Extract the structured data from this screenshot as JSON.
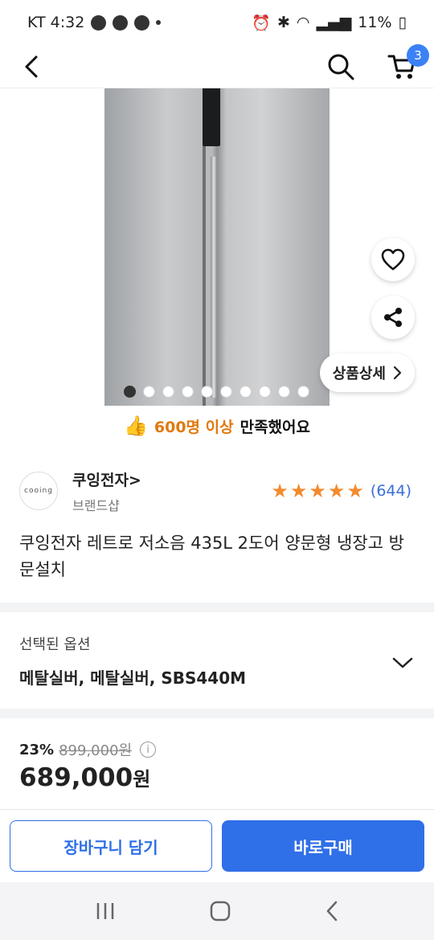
{
  "status_bar": {
    "carrier_time": "KT 4:32",
    "battery": "11%"
  },
  "app_bar": {
    "cart_count": "3"
  },
  "carousel": {
    "page_count": 10,
    "active_index": 0
  },
  "detail_button": {
    "label": "상품상세"
  },
  "satisfaction": {
    "highlight": "600명 이상",
    "rest": "만족했어요"
  },
  "seller": {
    "logo_text": "cooing",
    "name": "쿠잉전자>",
    "type": "브랜드샵"
  },
  "rating": {
    "stars": 5,
    "review_count": "(644)",
    "star_color": "#f28b2f"
  },
  "product": {
    "title": "쿠잉전자 레트로 저소음 435L 2도어 양문형 냉장고 방문설치"
  },
  "option": {
    "label": "선택된 옵션",
    "value": "메탈실버, 메탈실버, SBS440M"
  },
  "price": {
    "discount": "23%",
    "original": "899,000원",
    "sale_number": "689,000",
    "sale_unit": "원"
  },
  "actions": {
    "cart_label": "장바구니 담기",
    "buy_label": "바로구매",
    "accent_color": "#2f6fe8"
  },
  "icons": [
    "back-arrow-icon",
    "search-icon",
    "cart-icon",
    "heart-icon",
    "share-icon",
    "chevron-right-icon",
    "thumbs-up-icon",
    "star-icon",
    "info-icon",
    "chevron-down-icon",
    "recent-apps-icon",
    "home-icon",
    "nav-back-icon"
  ]
}
